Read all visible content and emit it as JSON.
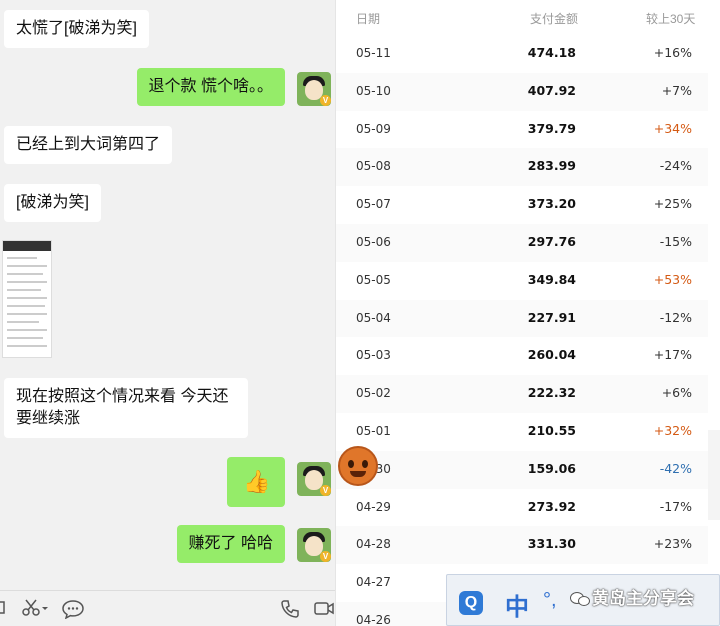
{
  "chat": {
    "messages": [
      {
        "side": "in",
        "text": "太慌了[破涕为笑]"
      },
      {
        "side": "out",
        "text": "退个款 慌个啥。。"
      },
      {
        "side": "in",
        "text": "已经上到大词第四了"
      },
      {
        "side": "in",
        "text": "[破涕为笑]"
      },
      {
        "side": "in",
        "text": "现在按照这个情况来看 今天还要继续涨"
      },
      {
        "side": "out",
        "text": "👍"
      },
      {
        "side": "out",
        "text": "赚死了  哈哈"
      }
    ],
    "avatar_badge": "V",
    "toolbar_icons": [
      "folder-icon",
      "scissors-icon",
      "chat-icon",
      "phone-icon",
      "video-icon"
    ]
  },
  "table": {
    "headers": {
      "date": "日期",
      "amount": "支付金额",
      "compare": "较上30天"
    },
    "rows": [
      {
        "date": "05-11",
        "amount": "474.18",
        "compare": "+16%",
        "hi": ""
      },
      {
        "date": "05-10",
        "amount": "407.92",
        "compare": "+7%",
        "hi": ""
      },
      {
        "date": "05-09",
        "amount": "379.79",
        "compare": "+34%",
        "hi": "up"
      },
      {
        "date": "05-08",
        "amount": "283.99",
        "compare": "-24%",
        "hi": ""
      },
      {
        "date": "05-07",
        "amount": "373.20",
        "compare": "+25%",
        "hi": ""
      },
      {
        "date": "05-06",
        "amount": "297.76",
        "compare": "-15%",
        "hi": ""
      },
      {
        "date": "05-05",
        "amount": "349.84",
        "compare": "+53%",
        "hi": "up"
      },
      {
        "date": "05-04",
        "amount": "227.91",
        "compare": "-12%",
        "hi": ""
      },
      {
        "date": "05-03",
        "amount": "260.04",
        "compare": "+17%",
        "hi": ""
      },
      {
        "date": "05-02",
        "amount": "222.32",
        "compare": "+6%",
        "hi": ""
      },
      {
        "date": "05-01",
        "amount": "210.55",
        "compare": "+32%",
        "hi": "up"
      },
      {
        "date": "04-30",
        "amount": "159.06",
        "compare": "-42%",
        "hi": "down"
      },
      {
        "date": "04-29",
        "amount": "273.92",
        "compare": "-17%",
        "hi": ""
      },
      {
        "date": "04-28",
        "amount": "331.30",
        "compare": "+23%",
        "hi": ""
      },
      {
        "date": "04-27",
        "amount": "",
        "compare": "",
        "hi": ""
      },
      {
        "date": "04-26",
        "amount": "",
        "compare": "",
        "hi": ""
      }
    ]
  },
  "ime": {
    "logo": "Q",
    "mode": "中",
    "punct": "°,"
  },
  "watermark": "黄岛主分享会",
  "colors": {
    "chat_out": "#95ec69",
    "chat_in": "#ffffff",
    "up_highlight": "#d45a14",
    "down_highlight": "#2f6fb0"
  }
}
